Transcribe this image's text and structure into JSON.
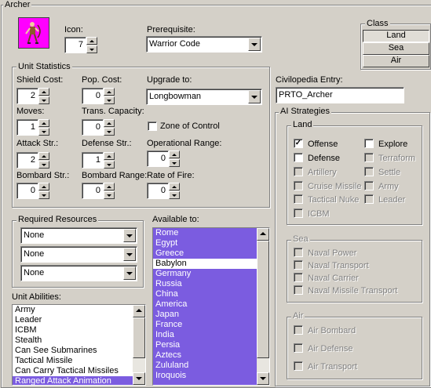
{
  "window": {
    "title": "Archer"
  },
  "icon": {
    "label": "Icon:",
    "value": "7",
    "image": "archer-unit-icon"
  },
  "prerequisite": {
    "label": "Prerequisite:",
    "value": "Warrior Code"
  },
  "class_group": {
    "title": "Class",
    "options": [
      "Land",
      "Sea",
      "Air"
    ],
    "selected": "Land"
  },
  "unit_stats": {
    "title": "Unit Statistics",
    "shield_cost": {
      "label": "Shield Cost:",
      "value": "2"
    },
    "pop_cost": {
      "label": "Pop. Cost:",
      "value": "0"
    },
    "upgrade_to": {
      "label": "Upgrade to:",
      "value": "Longbowman"
    },
    "moves": {
      "label": "Moves:",
      "value": "1"
    },
    "trans_capacity": {
      "label": "Trans. Capacity:",
      "value": "0"
    },
    "zone_of_control": {
      "label": "Zone of Control",
      "checked": false
    },
    "attack": {
      "label": "Attack Str.:",
      "value": "2"
    },
    "defense": {
      "label": "Defense Str.:",
      "value": "1"
    },
    "operational_range": {
      "label": "Operational Range:",
      "value": "0"
    },
    "bombard": {
      "label": "Bombard Str.:",
      "value": "0"
    },
    "bombard_range": {
      "label": "Bombard Range:",
      "value": "0"
    },
    "rate_of_fire": {
      "label": "Rate of Fire:",
      "value": "0"
    }
  },
  "civilopedia": {
    "label": "Civilopedia Entry:",
    "value": "PRTO_Archer"
  },
  "ai_strategies": {
    "title": "AI Strategies",
    "land": {
      "title": "Land",
      "offense": {
        "label": "Offense",
        "checked": true
      },
      "explore": {
        "label": "Explore",
        "checked": false
      },
      "defense": {
        "label": "Defense",
        "checked": false
      },
      "terraform": {
        "label": "Terraform"
      },
      "artillery": {
        "label": "Artillery"
      },
      "settle": {
        "label": "Settle"
      },
      "cruise_missile": {
        "label": "Cruise Missile"
      },
      "army": {
        "label": "Army"
      },
      "tactical_nuke": {
        "label": "Tactical Nuke"
      },
      "leader": {
        "label": "Leader"
      },
      "icbm": {
        "label": "ICBM"
      }
    },
    "sea": {
      "title": "Sea",
      "items": [
        "Naval Power",
        "Naval Transport",
        "Naval Carrier",
        "Naval Missile Transport"
      ]
    },
    "air": {
      "title": "Air",
      "items": [
        "Air Bombard",
        "Air Defense",
        "Air Transport"
      ]
    }
  },
  "required_resources": {
    "title": "Required Resources",
    "values": [
      "None",
      "None",
      "None"
    ]
  },
  "available_to": {
    "title": "Available to:",
    "items": [
      "Rome",
      "Egypt",
      "Greece",
      "Babylon",
      "Germany",
      "Russia",
      "China",
      "America",
      "Japan",
      "France",
      "India",
      "Persia",
      "Aztecs",
      "Zululand",
      "Iroquois"
    ],
    "selected_index": 3
  },
  "unit_abilities": {
    "title": "Unit Abilities:",
    "items": [
      "Army",
      "Leader",
      "ICBM",
      "Stealth",
      "Can See Submarines",
      "Tactical Missile",
      "Can Carry Tactical Missiles",
      "Ranged Attack Animation"
    ],
    "selected_index": 7
  },
  "colors": {
    "panel": "#d4d0c8",
    "selection": "#7b5ce0",
    "icon_bg": "#ff00ff"
  }
}
